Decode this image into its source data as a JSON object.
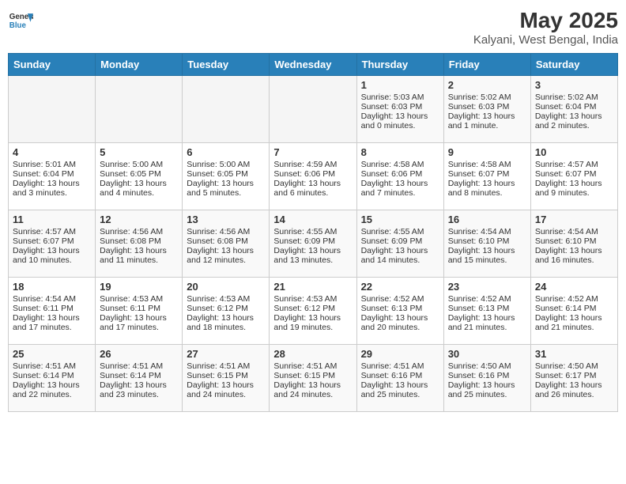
{
  "logo": {
    "general": "General",
    "blue": "Blue"
  },
  "title": "May 2025",
  "subtitle": "Kalyani, West Bengal, India",
  "headers": [
    "Sunday",
    "Monday",
    "Tuesday",
    "Wednesday",
    "Thursday",
    "Friday",
    "Saturday"
  ],
  "weeks": [
    [
      {
        "day": "",
        "lines": []
      },
      {
        "day": "",
        "lines": []
      },
      {
        "day": "",
        "lines": []
      },
      {
        "day": "",
        "lines": []
      },
      {
        "day": "1",
        "lines": [
          "Sunrise: 5:03 AM",
          "Sunset: 6:03 PM",
          "Daylight: 13 hours",
          "and 0 minutes."
        ]
      },
      {
        "day": "2",
        "lines": [
          "Sunrise: 5:02 AM",
          "Sunset: 6:03 PM",
          "Daylight: 13 hours",
          "and 1 minute."
        ]
      },
      {
        "day": "3",
        "lines": [
          "Sunrise: 5:02 AM",
          "Sunset: 6:04 PM",
          "Daylight: 13 hours",
          "and 2 minutes."
        ]
      }
    ],
    [
      {
        "day": "4",
        "lines": [
          "Sunrise: 5:01 AM",
          "Sunset: 6:04 PM",
          "Daylight: 13 hours",
          "and 3 minutes."
        ]
      },
      {
        "day": "5",
        "lines": [
          "Sunrise: 5:00 AM",
          "Sunset: 6:05 PM",
          "Daylight: 13 hours",
          "and 4 minutes."
        ]
      },
      {
        "day": "6",
        "lines": [
          "Sunrise: 5:00 AM",
          "Sunset: 6:05 PM",
          "Daylight: 13 hours",
          "and 5 minutes."
        ]
      },
      {
        "day": "7",
        "lines": [
          "Sunrise: 4:59 AM",
          "Sunset: 6:06 PM",
          "Daylight: 13 hours",
          "and 6 minutes."
        ]
      },
      {
        "day": "8",
        "lines": [
          "Sunrise: 4:58 AM",
          "Sunset: 6:06 PM",
          "Daylight: 13 hours",
          "and 7 minutes."
        ]
      },
      {
        "day": "9",
        "lines": [
          "Sunrise: 4:58 AM",
          "Sunset: 6:07 PM",
          "Daylight: 13 hours",
          "and 8 minutes."
        ]
      },
      {
        "day": "10",
        "lines": [
          "Sunrise: 4:57 AM",
          "Sunset: 6:07 PM",
          "Daylight: 13 hours",
          "and 9 minutes."
        ]
      }
    ],
    [
      {
        "day": "11",
        "lines": [
          "Sunrise: 4:57 AM",
          "Sunset: 6:07 PM",
          "Daylight: 13 hours",
          "and 10 minutes."
        ]
      },
      {
        "day": "12",
        "lines": [
          "Sunrise: 4:56 AM",
          "Sunset: 6:08 PM",
          "Daylight: 13 hours",
          "and 11 minutes."
        ]
      },
      {
        "day": "13",
        "lines": [
          "Sunrise: 4:56 AM",
          "Sunset: 6:08 PM",
          "Daylight: 13 hours",
          "and 12 minutes."
        ]
      },
      {
        "day": "14",
        "lines": [
          "Sunrise: 4:55 AM",
          "Sunset: 6:09 PM",
          "Daylight: 13 hours",
          "and 13 minutes."
        ]
      },
      {
        "day": "15",
        "lines": [
          "Sunrise: 4:55 AM",
          "Sunset: 6:09 PM",
          "Daylight: 13 hours",
          "and 14 minutes."
        ]
      },
      {
        "day": "16",
        "lines": [
          "Sunrise: 4:54 AM",
          "Sunset: 6:10 PM",
          "Daylight: 13 hours",
          "and 15 minutes."
        ]
      },
      {
        "day": "17",
        "lines": [
          "Sunrise: 4:54 AM",
          "Sunset: 6:10 PM",
          "Daylight: 13 hours",
          "and 16 minutes."
        ]
      }
    ],
    [
      {
        "day": "18",
        "lines": [
          "Sunrise: 4:54 AM",
          "Sunset: 6:11 PM",
          "Daylight: 13 hours",
          "and 17 minutes."
        ]
      },
      {
        "day": "19",
        "lines": [
          "Sunrise: 4:53 AM",
          "Sunset: 6:11 PM",
          "Daylight: 13 hours",
          "and 17 minutes."
        ]
      },
      {
        "day": "20",
        "lines": [
          "Sunrise: 4:53 AM",
          "Sunset: 6:12 PM",
          "Daylight: 13 hours",
          "and 18 minutes."
        ]
      },
      {
        "day": "21",
        "lines": [
          "Sunrise: 4:53 AM",
          "Sunset: 6:12 PM",
          "Daylight: 13 hours",
          "and 19 minutes."
        ]
      },
      {
        "day": "22",
        "lines": [
          "Sunrise: 4:52 AM",
          "Sunset: 6:13 PM",
          "Daylight: 13 hours",
          "and 20 minutes."
        ]
      },
      {
        "day": "23",
        "lines": [
          "Sunrise: 4:52 AM",
          "Sunset: 6:13 PM",
          "Daylight: 13 hours",
          "and 21 minutes."
        ]
      },
      {
        "day": "24",
        "lines": [
          "Sunrise: 4:52 AM",
          "Sunset: 6:14 PM",
          "Daylight: 13 hours",
          "and 21 minutes."
        ]
      }
    ],
    [
      {
        "day": "25",
        "lines": [
          "Sunrise: 4:51 AM",
          "Sunset: 6:14 PM",
          "Daylight: 13 hours",
          "and 22 minutes."
        ]
      },
      {
        "day": "26",
        "lines": [
          "Sunrise: 4:51 AM",
          "Sunset: 6:14 PM",
          "Daylight: 13 hours",
          "and 23 minutes."
        ]
      },
      {
        "day": "27",
        "lines": [
          "Sunrise: 4:51 AM",
          "Sunset: 6:15 PM",
          "Daylight: 13 hours",
          "and 24 minutes."
        ]
      },
      {
        "day": "28",
        "lines": [
          "Sunrise: 4:51 AM",
          "Sunset: 6:15 PM",
          "Daylight: 13 hours",
          "and 24 minutes."
        ]
      },
      {
        "day": "29",
        "lines": [
          "Sunrise: 4:51 AM",
          "Sunset: 6:16 PM",
          "Daylight: 13 hours",
          "and 25 minutes."
        ]
      },
      {
        "day": "30",
        "lines": [
          "Sunrise: 4:50 AM",
          "Sunset: 6:16 PM",
          "Daylight: 13 hours",
          "and 25 minutes."
        ]
      },
      {
        "day": "31",
        "lines": [
          "Sunrise: 4:50 AM",
          "Sunset: 6:17 PM",
          "Daylight: 13 hours",
          "and 26 minutes."
        ]
      }
    ]
  ]
}
